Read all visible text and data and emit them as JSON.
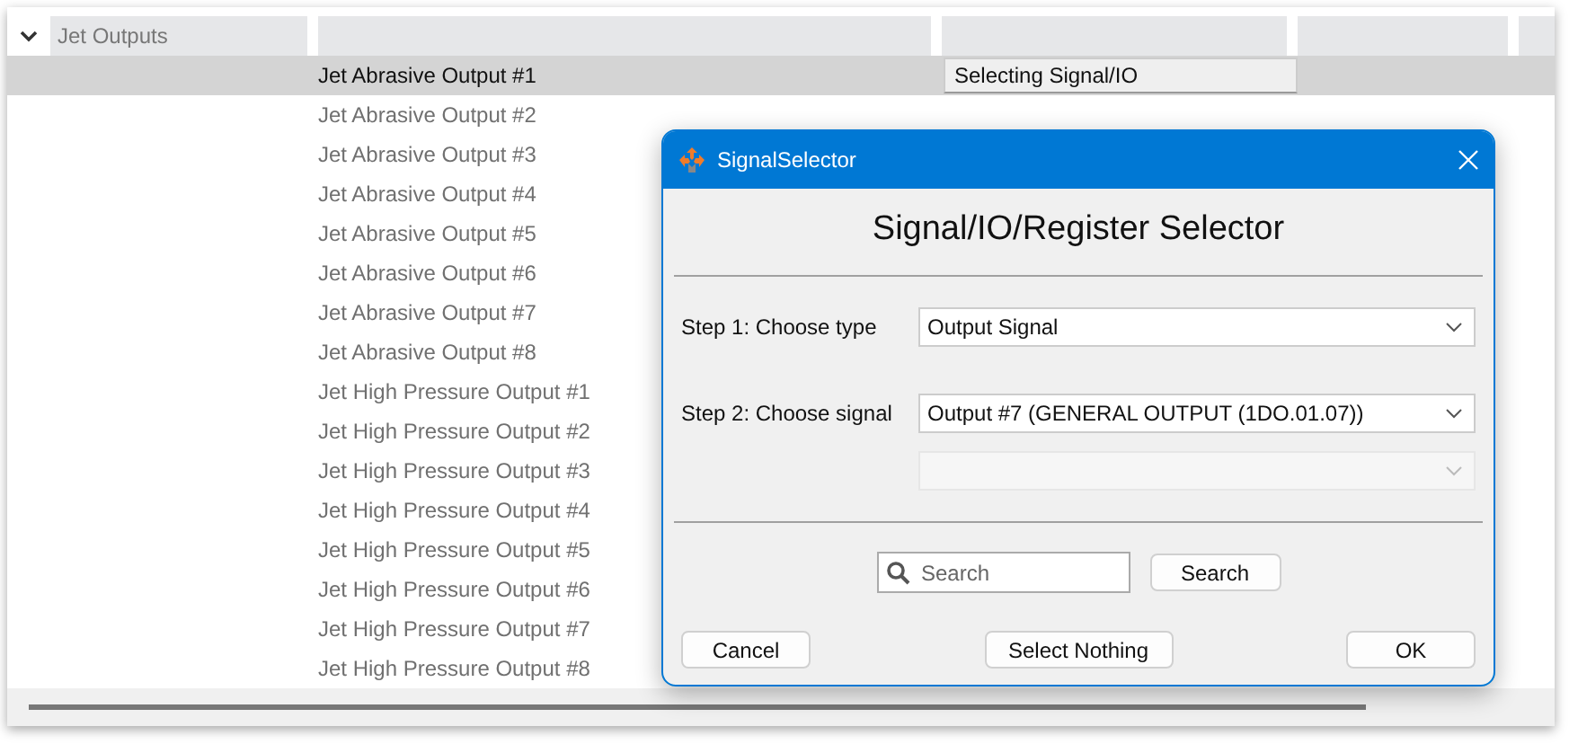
{
  "table": {
    "group": {
      "label": "Jet Outputs",
      "expanded": true
    },
    "rows": [
      {
        "label": "Jet Abrasive Output #1",
        "selected": true,
        "editor": "Selecting Signal/IO"
      },
      {
        "label": "Jet Abrasive Output #2",
        "selected": false
      },
      {
        "label": "Jet Abrasive Output #3",
        "selected": false
      },
      {
        "label": "Jet Abrasive Output #4",
        "selected": false
      },
      {
        "label": "Jet Abrasive Output #5",
        "selected": false
      },
      {
        "label": "Jet Abrasive Output #6",
        "selected": false
      },
      {
        "label": "Jet Abrasive Output #7",
        "selected": false
      },
      {
        "label": "Jet Abrasive Output #8",
        "selected": false
      },
      {
        "label": "Jet High Pressure Output #1",
        "selected": false
      },
      {
        "label": "Jet High Pressure Output #2",
        "selected": false
      },
      {
        "label": "Jet High Pressure Output #3",
        "selected": false
      },
      {
        "label": "Jet High Pressure Output #4",
        "selected": false
      },
      {
        "label": "Jet High Pressure Output #5",
        "selected": false
      },
      {
        "label": "Jet High Pressure Output #6",
        "selected": false
      },
      {
        "label": "Jet High Pressure Output #7",
        "selected": false
      },
      {
        "label": "Jet High Pressure Output #8",
        "selected": false
      }
    ]
  },
  "dialog": {
    "title": "SignalSelector",
    "heading": "Signal/IO/Register Selector",
    "fields": [
      {
        "label": "Step 1: Choose type",
        "value": "Output Signal",
        "disabled": false
      },
      {
        "label": "Step 2: Choose signal",
        "value": "Output #7 (GENERAL OUTPUT (1DO.01.07))",
        "disabled": false
      },
      {
        "disabled": true
      }
    ],
    "search": {
      "placeholder": "Search",
      "button": "Search"
    },
    "buttons": [
      "Cancel",
      "Select Nothing",
      "OK"
    ]
  }
}
